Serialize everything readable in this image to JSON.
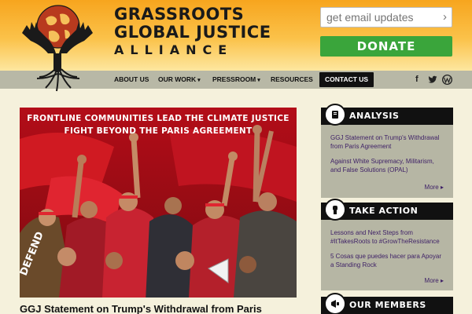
{
  "brand": {
    "line1": "GRASSROOTS",
    "line2": "GLOBAL JUSTICE",
    "line3": "ALLIANCE"
  },
  "header": {
    "email_placeholder": "get email updates",
    "email_go": "›",
    "donate_label": "DONATE"
  },
  "nav": {
    "items": [
      {
        "label": "ABOUT US",
        "has_caret": false
      },
      {
        "label": "OUR WORK",
        "has_caret": true
      },
      {
        "label": "PRESSROOM",
        "has_caret": true
      },
      {
        "label": "RESOURCES",
        "has_caret": false
      },
      {
        "label": "CONTACT US",
        "has_caret": false
      }
    ],
    "caret": "▾",
    "social": [
      "f",
      "twitter-icon",
      "wordpress-icon"
    ]
  },
  "hero": {
    "caption_line1": "FRONTLINE COMMUNITIES LEAD THE CLIMATE JUSTICE",
    "caption_line2": "FIGHT BEYOND THE PARIS AGREEMENT",
    "banner_text": "DEFEND"
  },
  "article": {
    "title": "GGJ Statement on Trump's Withdrawal from Paris"
  },
  "sidebar": {
    "analysis": {
      "heading": "ANALYSIS",
      "links": [
        "GGJ Statement on Trump's Withdrawal from Paris Agreement",
        "Against White Supremacy, Militarism, and False Solutions (OPAL)"
      ],
      "more": "More ▸"
    },
    "take_action": {
      "heading": "TAKE ACTION",
      "links": [
        "Lessons and Next Steps from #ItTakesRoots to #GrowTheResistance",
        "5 Cosas que puedes hacer para Apoyar a Standing Rock"
      ],
      "more": "More ▸"
    },
    "members": {
      "heading": "OUR MEMBERS"
    }
  },
  "colors": {
    "accent_green": "#3aa53b",
    "nav_bg": "#b8b8a6",
    "link_purple": "#3d1f66",
    "hero_red": "#8a0a12"
  }
}
